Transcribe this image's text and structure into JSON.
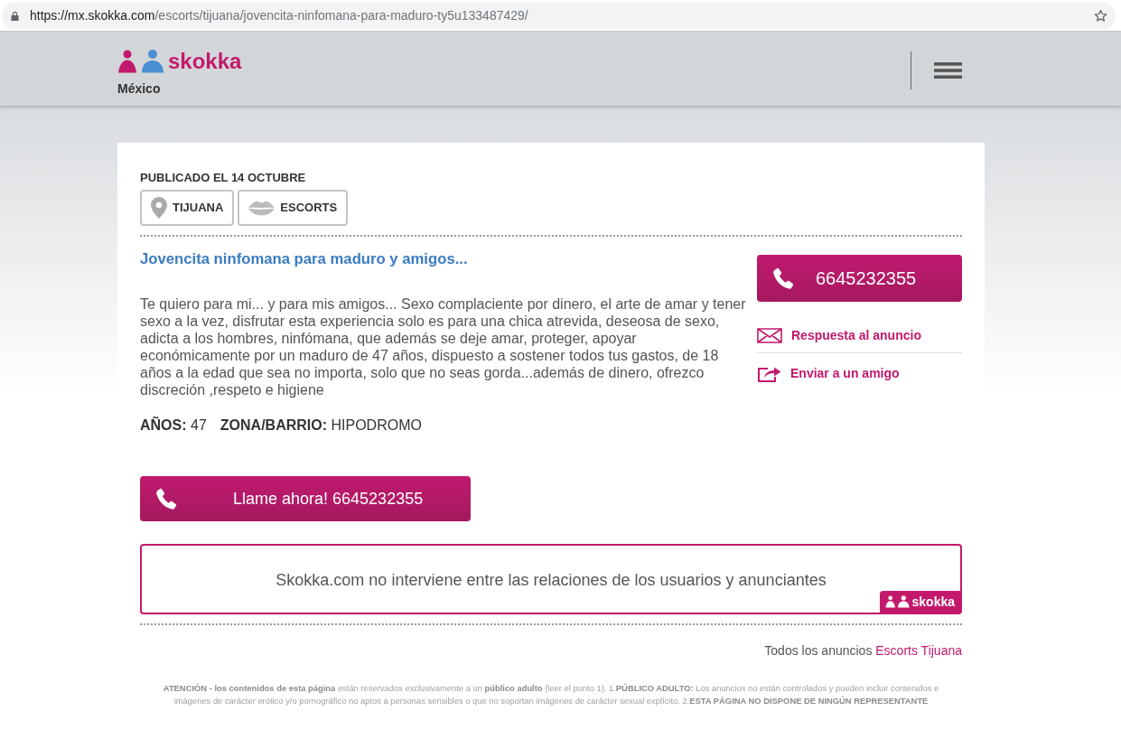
{
  "browser": {
    "url_host": "https://mx.skokka.com",
    "url_path": "/escorts/tijuana/jovencita-ninfomana-para-maduro-ty5u133487429/"
  },
  "header": {
    "logo_text": "skokka",
    "country": "México"
  },
  "ad": {
    "published": "PUBLICADO EL 14 OCTUBRE",
    "tags": [
      {
        "kind": "location",
        "label": "TIJUANA"
      },
      {
        "kind": "category",
        "label": "ESCORTS"
      }
    ],
    "title": "Jovencita ninfomana para maduro y amigos...",
    "description": "Te quiero para mi... y para mis amigos... Sexo complaciente por dinero, el arte de amar y tener sexo a la vez, disfrutar esta experiencia solo es para una chica atrevida, deseosa de sexo, adicta a los hombres, ninfómana, que además se deje amar, proteger, apoyar económicamente por un maduro de 47 años, dispuesto a sostener todos tus gastos, de 18 años a la edad que sea no importa, solo que no seas gorda...además de dinero, ofrezco discreción ,respeto e higiene",
    "details": [
      {
        "label": "AÑOS:",
        "value": "47"
      },
      {
        "label": "ZONA/BARRIO:",
        "value": "HIPODROMO"
      }
    ],
    "call_button": "Llame ahora! 6645232355"
  },
  "contact": {
    "phone": "6645232355",
    "actions": [
      {
        "kind": "reply",
        "label": "Respuesta al anuncio"
      },
      {
        "kind": "share",
        "label": "Enviar a un amigo"
      }
    ]
  },
  "disclaimer": {
    "text": "Skokka.com no interviene entre las relaciones de los usuarios y anunciantes",
    "badge_text": "skokka"
  },
  "all_ads": {
    "prefix": "Todos los anuncios",
    "link": "Escorts Tijuana"
  },
  "footer_notice": "**ATENCIÓN - los contenidos de esta página** están reservados exclusivamente a un **público adulto** (leer el punto 1). 1.**PÚBLICO ADULTO:** Los anuncios no están controlados y pueden incluir contenidos e imágenes de carácter erótico y/o pornográfico no aptos a personas sensibles o que no soportan imágenes de carácter sexual explícito. 2.**ESTA PÁGINA NO DISPONE DE NINGÚN REPRESENTANTE**"
}
